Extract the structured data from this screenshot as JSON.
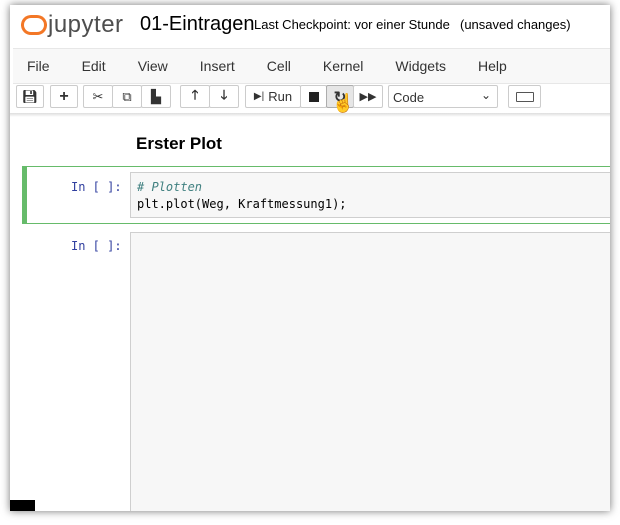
{
  "header": {
    "logo": "jupyter",
    "notebook_name": "01-Eintragen",
    "checkpoint": "Last Checkpoint: vor einer Stunde",
    "status": "(unsaved changes)"
  },
  "menu": [
    "File",
    "Edit",
    "View",
    "Insert",
    "Cell",
    "Kernel",
    "Widgets",
    "Help"
  ],
  "toolbar": {
    "run_label": "Run",
    "cell_type": "Code"
  },
  "notebook": {
    "heading": "Erster Plot",
    "cells": [
      {
        "prompt": "In [ ]:",
        "comment": "# Plotten",
        "code": "plt.plot(Weg, Kraftmessung1);"
      },
      {
        "prompt": "In [ ]:",
        "code": ""
      }
    ]
  },
  "colors": {
    "accent": "#f37726",
    "selected": "#66bb6a"
  }
}
